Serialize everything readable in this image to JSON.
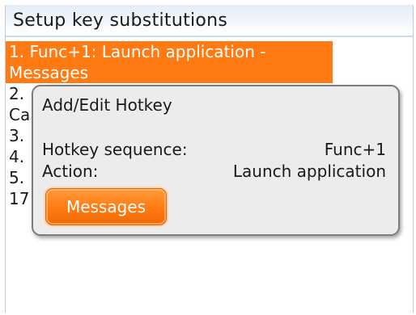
{
  "screen": {
    "title": "Setup key substitutions"
  },
  "list": {
    "items": [
      {
        "line1": "1. Func+1: Launch application -",
        "line2": "Messages",
        "selected": true
      },
      {
        "line1": "2.",
        "line2": "Ca",
        "selected": false
      },
      {
        "line1": "3.",
        "selected": false
      },
      {
        "line1": "4.",
        "selected": false
      },
      {
        "line1": "5.",
        "selected": false
      },
      {
        "line1": "17",
        "selected": false
      }
    ]
  },
  "dialog": {
    "title": "Add/Edit Hotkey",
    "hotkey_label": "Hotkey sequence:",
    "hotkey_value": "Func+1",
    "action_label": "Action:",
    "action_value": "Launch application",
    "button_label": "Messages"
  },
  "colors": {
    "accent": "#ff7a12",
    "title_gradient_top": "#e4edf8",
    "dialog_bg": "#ececec",
    "dialog_border": "#7d7d7d"
  }
}
